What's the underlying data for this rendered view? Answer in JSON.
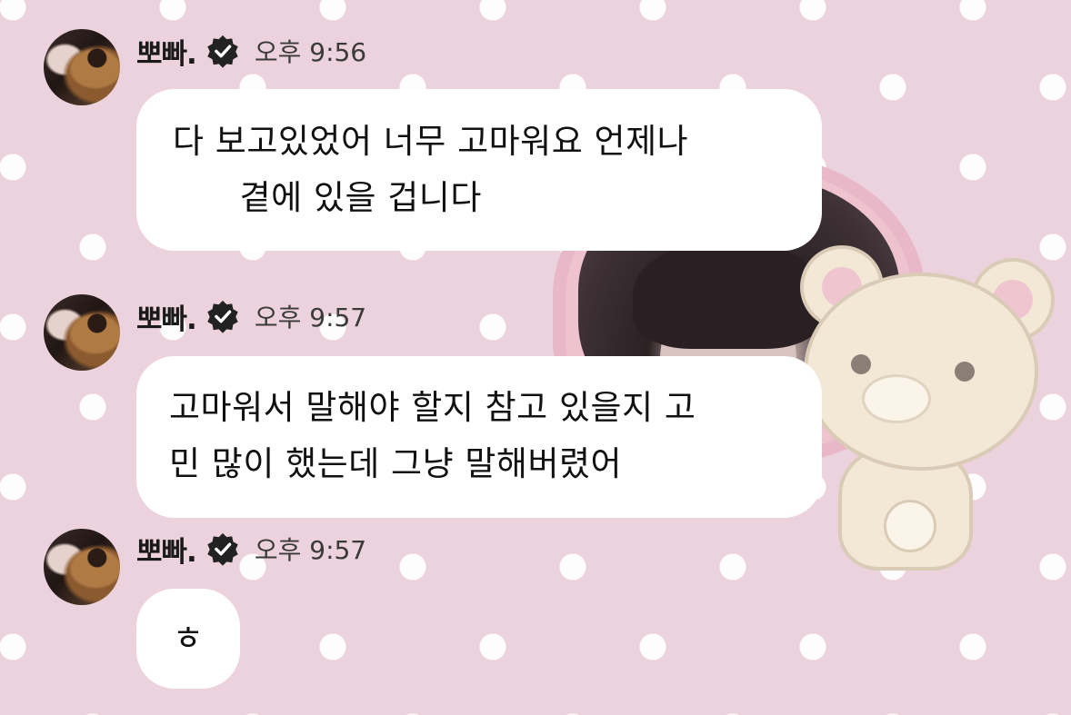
{
  "messages": [
    {
      "sender": "뽀빠.",
      "time": "오후 9:56",
      "text": "다 보고있었어 너무 고마워요 언제나\n      곁에 있을 겁니다"
    },
    {
      "sender": "뽀빠.",
      "time": "오후 9:57",
      "text": "고마워서 말해야 할지 참고 있을지 고\n민 많이 했는데 그냥 말해버렸어"
    },
    {
      "sender": "뽀빠.",
      "time": "오후 9:57",
      "text": "ㅎ"
    }
  ],
  "icons": {
    "verified": "verified-badge-icon"
  },
  "colors": {
    "background": "#ecd2dc",
    "bubble": "#ffffff",
    "sender_text": "#1a1a1a",
    "badge": "#222222"
  }
}
